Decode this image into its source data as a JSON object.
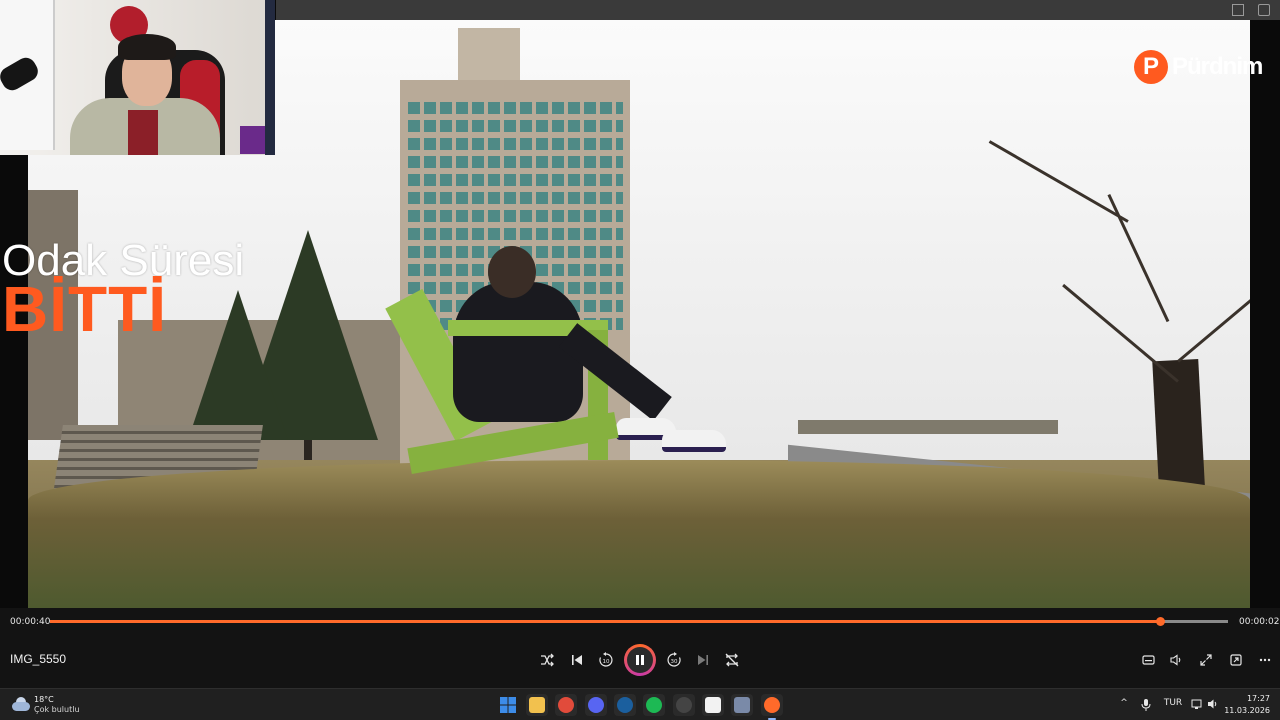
{
  "window": {
    "title": ""
  },
  "video": {
    "overlay_text_line1": "Odak Süresi",
    "overlay_text_line2": "BİTTİ",
    "watermark_word": "Pürdnim",
    "watermark_letter": "P",
    "accent_color": "#ff6a2a",
    "overlay_color": "#ff5a1f"
  },
  "player": {
    "file_title": "IMG_5550",
    "elapsed": "00:00:40",
    "remaining": "00:00:02",
    "progress_fraction": 0.942,
    "state": "playing",
    "buttons": {
      "shuffle_icon": "shuffle-icon",
      "previous_icon": "previous-icon",
      "rewind_icon": "rewind-10-icon",
      "play_pause_icon": "pause-icon",
      "forward_icon": "forward-30-icon",
      "next_icon": "next-icon",
      "repeat_icon": "repeat-off-icon",
      "subtitles_icon": "subtitles-icon",
      "volume_icon": "volume-icon",
      "fullscreen_icon": "fullscreen-icon",
      "miniplayer_icon": "miniplayer-icon",
      "more_icon": "more-icon"
    }
  },
  "taskbar": {
    "weather": {
      "temp": "18°C",
      "desc": "Çok bulutlu"
    },
    "apps": [
      {
        "name": "start-icon",
        "color": "#3d8ce8"
      },
      {
        "name": "file-explorer-icon",
        "color": "#f2c14e"
      },
      {
        "name": "chrome-icon",
        "color": "#e14b3b"
      },
      {
        "name": "discord-icon",
        "color": "#5865f2"
      },
      {
        "name": "steam-icon",
        "color": "#1b5f9e"
      },
      {
        "name": "spotify-icon",
        "color": "#1db954"
      },
      {
        "name": "obs-icon",
        "color": "#444444"
      },
      {
        "name": "capcut-icon",
        "color": "#f2f2f2"
      },
      {
        "name": "settings-icon",
        "color": "#7a8aa8"
      },
      {
        "name": "media-player-icon",
        "color": "#ff6a2a"
      }
    ],
    "tray": {
      "chevron": "^",
      "language": "TUR",
      "time": "17:27",
      "date": "11.03.2026"
    }
  }
}
